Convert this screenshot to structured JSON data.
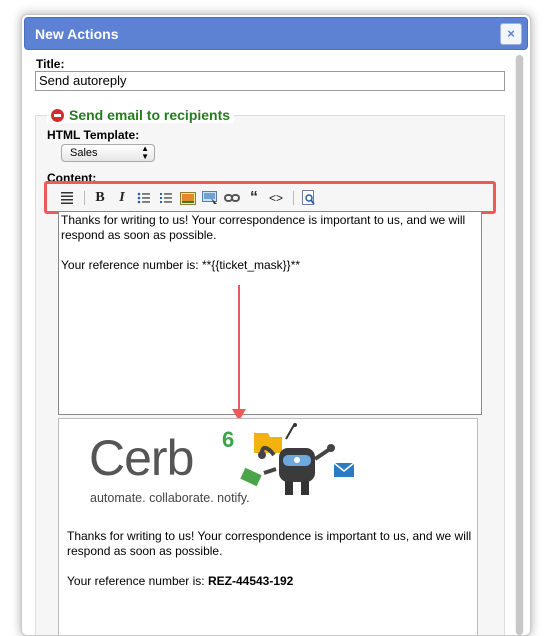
{
  "dialog": {
    "title": "New Actions",
    "close_label": "×"
  },
  "form": {
    "title_label": "Title:",
    "title_value": "Send autoreply",
    "section_legend": "Send email to recipients",
    "template_label": "HTML Template:",
    "template_selected": "Sales",
    "content_label": "Content:"
  },
  "toolbar": {
    "buttons": [
      "align-justify-icon",
      "bold-icon",
      "italic-icon",
      "bulleted-list-icon",
      "numbered-list-icon",
      "image-icon",
      "image-upload-icon",
      "link-icon",
      "quote-icon",
      "code-icon",
      "preview-icon"
    ],
    "bold_glyph": "B",
    "italic_glyph": "I",
    "quote_glyph": "“",
    "code_glyph": "<>"
  },
  "editor": {
    "line1": "Thanks for writing to us!  Your correspondence is important to us, and we will respond as soon as possible.",
    "line2": "Your reference number is: **{{ticket_mask}}**"
  },
  "preview": {
    "logo_word": "Cerb",
    "logo_sup": "6",
    "tagline": "automate. collaborate. notify.",
    "para1": "Thanks for writing to us! Your correspondence is important to us, and we will respond as soon as possible.",
    "ref_prefix": "Your reference number is: ",
    "ref_value": "REZ-44543-192"
  },
  "colors": {
    "titlebar": "#5d82d4",
    "legend_text": "#277b1f",
    "annotation": "#ec5b5b"
  }
}
